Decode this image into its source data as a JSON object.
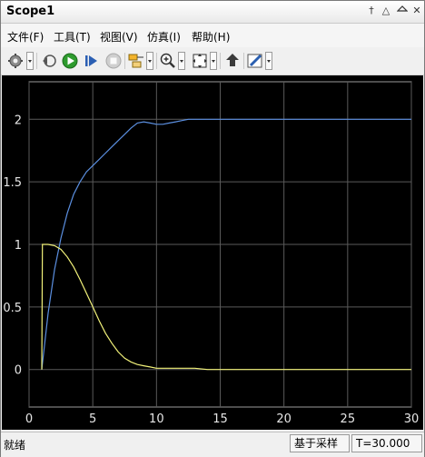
{
  "window": {
    "title": "Scope1"
  },
  "titlebar_controls": {
    "pin": "†",
    "minimize": "△",
    "close": "✕"
  },
  "menu": [
    {
      "label": "文件(F)"
    },
    {
      "label": "工具(T)"
    },
    {
      "label": "视图(V)"
    },
    {
      "label": "仿真(I)"
    },
    {
      "label": "帮助(H)"
    }
  ],
  "toolbar": {
    "icons": [
      "settings-gear-icon",
      "restore-icon",
      "run-icon",
      "step-forward-icon",
      "stop-icon",
      "signal-select-icon",
      "zoom-in-icon",
      "fit-axes-icon",
      "highlight-block-icon",
      "edit-style-icon"
    ]
  },
  "colors": {
    "plot_bg": "#000000",
    "grid": "#5a5a5a",
    "series_blue": "#5b8fe0",
    "series_yellow": "#f2f27a",
    "tick_text": "#e6e6e6"
  },
  "chart_data": {
    "type": "line",
    "title": "",
    "xlabel": "",
    "ylabel": "",
    "xlim": [
      0,
      30
    ],
    "ylim": [
      -0.3,
      2.3
    ],
    "x_ticks": [
      "0",
      "5",
      "10",
      "15",
      "20",
      "25",
      "30"
    ],
    "y_ticks": [
      "0",
      "0.5",
      "1",
      "1.5",
      "2"
    ],
    "grid": true,
    "series": [
      {
        "color": "#5b8fe0",
        "x": [
          1,
          1.5,
          2,
          2.5,
          3,
          3.5,
          4,
          4.5,
          5,
          5.5,
          6,
          6.5,
          7,
          7.5,
          8,
          8.5,
          9,
          9.5,
          10,
          10.5,
          11,
          11.5,
          12,
          12.5,
          13,
          14,
          15,
          16,
          17,
          18,
          19,
          20,
          22,
          24,
          26,
          28,
          30
        ],
        "y": [
          0,
          0.45,
          0.8,
          1.05,
          1.25,
          1.4,
          1.5,
          1.58,
          1.63,
          1.68,
          1.73,
          1.78,
          1.83,
          1.88,
          1.93,
          1.97,
          1.98,
          1.97,
          1.96,
          1.96,
          1.97,
          1.98,
          1.99,
          2.0,
          2.0,
          2.0,
          2.0,
          2.0,
          2.0,
          2.0,
          2.0,
          2.0,
          2.0,
          2.0,
          2.0,
          2.0,
          2.0
        ]
      },
      {
        "color": "#f2f27a",
        "x": [
          1,
          1.05,
          1.5,
          2,
          2.5,
          3,
          3.5,
          4,
          4.5,
          5,
          5.5,
          6,
          6.5,
          7,
          7.5,
          8,
          8.5,
          9,
          9.5,
          10,
          11,
          12,
          13,
          14,
          15,
          16,
          18,
          20,
          25,
          30
        ],
        "y": [
          0,
          1.0,
          1.0,
          0.99,
          0.96,
          0.9,
          0.82,
          0.72,
          0.61,
          0.5,
          0.39,
          0.29,
          0.21,
          0.14,
          0.09,
          0.06,
          0.04,
          0.03,
          0.02,
          0.01,
          0.01,
          0.01,
          0.01,
          0.0,
          0.0,
          0.0,
          0.0,
          0.0,
          0.0,
          0.0
        ]
      }
    ]
  },
  "status": {
    "ready": "就绪",
    "sample_mode": "基于采样",
    "time": "T=30.000"
  }
}
